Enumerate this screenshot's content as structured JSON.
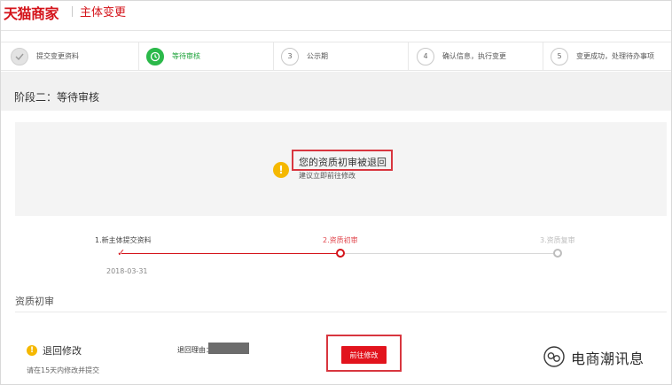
{
  "header": {
    "brand": "天猫商家",
    "subtitle": "主体变更"
  },
  "steps": [
    {
      "number": "✓",
      "label": "提交变更资料",
      "state": "done"
    },
    {
      "number": "◷",
      "label": "等待审核",
      "state": "active"
    },
    {
      "number": "3",
      "label": "公示期",
      "state": "pending"
    },
    {
      "number": "4",
      "label": "确认信息，执行变更",
      "state": "pending"
    },
    {
      "number": "5",
      "label": "变更成功，处理待办事项",
      "state": "pending"
    }
  ],
  "stage": {
    "title": "阶段二：等待审核"
  },
  "alert": {
    "icon": "warning-icon",
    "title": "您的资质初审被退回",
    "subtitle": "建议立即前往修改"
  },
  "progress": {
    "stages": [
      {
        "label": "1.新主体提交资料",
        "state": "done"
      },
      {
        "label": "2.资质初审",
        "state": "current"
      },
      {
        "label": "3.资质复审",
        "state": "pending"
      }
    ],
    "date": "2018-03-31"
  },
  "review": {
    "section_title": "资质初审",
    "status": "退回修改",
    "note": "请在15天内修改并提交",
    "reason_label": "退回理由：",
    "modify_button": "前往修改"
  },
  "watermark": {
    "text": "电商潮讯息"
  },
  "colors": {
    "brand_red": "#d4131a",
    "active_green": "#2bb94a",
    "warning_yellow": "#f5b800",
    "highlight_red": "#d8363f"
  }
}
